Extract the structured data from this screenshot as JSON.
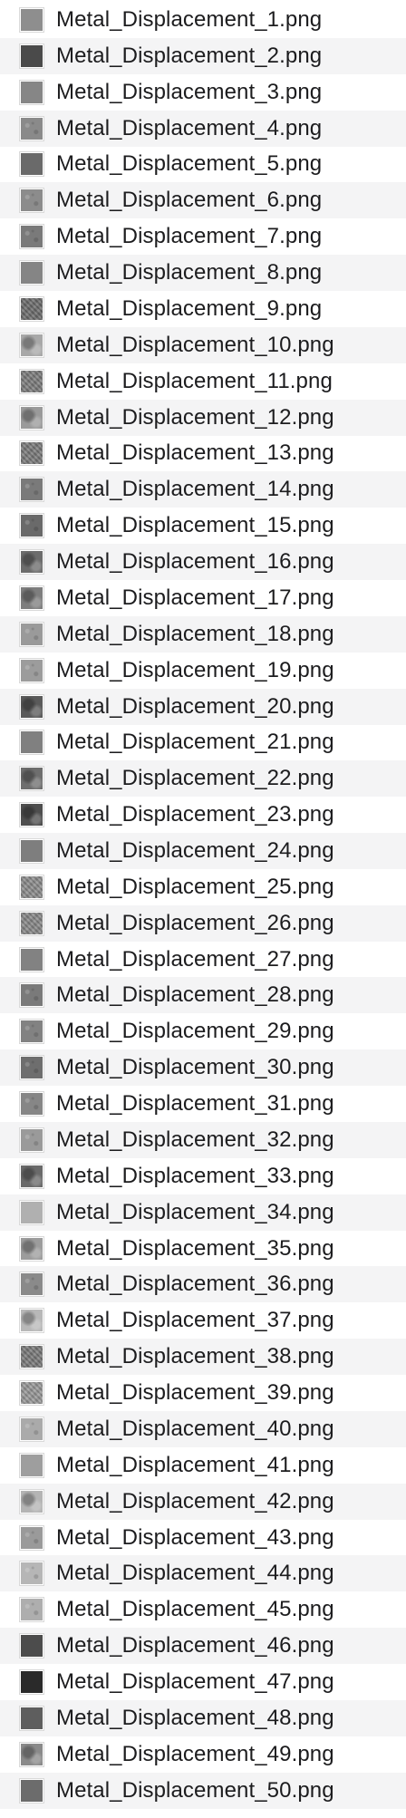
{
  "files": [
    {
      "name": "Metal_Displacement_1.png",
      "tone": "#8e8e8e",
      "texture": "smooth"
    },
    {
      "name": "Metal_Displacement_2.png",
      "tone": "#4a4a4a",
      "texture": "smooth"
    },
    {
      "name": "Metal_Displacement_3.png",
      "tone": "#868686",
      "texture": "smooth"
    },
    {
      "name": "Metal_Displacement_4.png",
      "tone": "#8a8a8a",
      "texture": "speckle"
    },
    {
      "name": "Metal_Displacement_5.png",
      "tone": "#6a6a6a",
      "texture": "smooth"
    },
    {
      "name": "Metal_Displacement_6.png",
      "tone": "#8c8c8c",
      "texture": "speckle"
    },
    {
      "name": "Metal_Displacement_7.png",
      "tone": "#7a7a7a",
      "texture": "speckle"
    },
    {
      "name": "Metal_Displacement_8.png",
      "tone": "#858585",
      "texture": "smooth"
    },
    {
      "name": "Metal_Displacement_9.png",
      "tone": "#6e6e6e",
      "texture": "noise"
    },
    {
      "name": "Metal_Displacement_10.png",
      "tone": "#a8a8a8",
      "texture": "blotch"
    },
    {
      "name": "Metal_Displacement_11.png",
      "tone": "#7e7e7e",
      "texture": "noise"
    },
    {
      "name": "Metal_Displacement_12.png",
      "tone": "#9a9a9a",
      "texture": "blotch"
    },
    {
      "name": "Metal_Displacement_13.png",
      "tone": "#7c7c7c",
      "texture": "noise"
    },
    {
      "name": "Metal_Displacement_14.png",
      "tone": "#7a7a7a",
      "texture": "speckle"
    },
    {
      "name": "Metal_Displacement_15.png",
      "tone": "#6a6a6a",
      "texture": "speckle"
    },
    {
      "name": "Metal_Displacement_16.png",
      "tone": "#6c6c6c",
      "texture": "blotch"
    },
    {
      "name": "Metal_Displacement_17.png",
      "tone": "#7e7e7e",
      "texture": "blotch"
    },
    {
      "name": "Metal_Displacement_18.png",
      "tone": "#9a9a9a",
      "texture": "speckle"
    },
    {
      "name": "Metal_Displacement_19.png",
      "tone": "#9c9c9c",
      "texture": "speckle"
    },
    {
      "name": "Metal_Displacement_20.png",
      "tone": "#5a5a5a",
      "texture": "blotch"
    },
    {
      "name": "Metal_Displacement_21.png",
      "tone": "#808080",
      "texture": "smooth"
    },
    {
      "name": "Metal_Displacement_22.png",
      "tone": "#6e6e6e",
      "texture": "blotch"
    },
    {
      "name": "Metal_Displacement_23.png",
      "tone": "#4e4e4e",
      "texture": "blotch"
    },
    {
      "name": "Metal_Displacement_24.png",
      "tone": "#7e7e7e",
      "texture": "smooth"
    },
    {
      "name": "Metal_Displacement_25.png",
      "tone": "#8e8e8e",
      "texture": "noise"
    },
    {
      "name": "Metal_Displacement_26.png",
      "tone": "#8a8a8a",
      "texture": "noise"
    },
    {
      "name": "Metal_Displacement_27.png",
      "tone": "#828282",
      "texture": "smooth"
    },
    {
      "name": "Metal_Displacement_28.png",
      "tone": "#7a7a7a",
      "texture": "speckle"
    },
    {
      "name": "Metal_Displacement_29.png",
      "tone": "#828282",
      "texture": "speckle"
    },
    {
      "name": "Metal_Displacement_30.png",
      "tone": "#6e6e6e",
      "texture": "speckle"
    },
    {
      "name": "Metal_Displacement_31.png",
      "tone": "#868686",
      "texture": "speckle"
    },
    {
      "name": "Metal_Displacement_32.png",
      "tone": "#9a9a9a",
      "texture": "speckle"
    },
    {
      "name": "Metal_Displacement_33.png",
      "tone": "#6a6a6a",
      "texture": "blotch"
    },
    {
      "name": "Metal_Displacement_34.png",
      "tone": "#b0b0b0",
      "texture": "smooth"
    },
    {
      "name": "Metal_Displacement_35.png",
      "tone": "#9c9c9c",
      "texture": "blotch"
    },
    {
      "name": "Metal_Displacement_36.png",
      "tone": "#8a8a8a",
      "texture": "speckle"
    },
    {
      "name": "Metal_Displacement_37.png",
      "tone": "#b8b8b8",
      "texture": "blotch"
    },
    {
      "name": "Metal_Displacement_38.png",
      "tone": "#7c7c7c",
      "texture": "noise"
    },
    {
      "name": "Metal_Displacement_39.png",
      "tone": "#9a9a9a",
      "texture": "noise"
    },
    {
      "name": "Metal_Displacement_40.png",
      "tone": "#aaaaaa",
      "texture": "speckle"
    },
    {
      "name": "Metal_Displacement_41.png",
      "tone": "#9e9e9e",
      "texture": "smooth"
    },
    {
      "name": "Metal_Displacement_42.png",
      "tone": "#b4b4b4",
      "texture": "blotch"
    },
    {
      "name": "Metal_Displacement_43.png",
      "tone": "#9a9a9a",
      "texture": "speckle"
    },
    {
      "name": "Metal_Displacement_44.png",
      "tone": "#b6b6b6",
      "texture": "speckle"
    },
    {
      "name": "Metal_Displacement_45.png",
      "tone": "#aeaeae",
      "texture": "speckle"
    },
    {
      "name": "Metal_Displacement_46.png",
      "tone": "#4c4c4c",
      "texture": "smooth"
    },
    {
      "name": "Metal_Displacement_47.png",
      "tone": "#2a2a2a",
      "texture": "smooth"
    },
    {
      "name": "Metal_Displacement_48.png",
      "tone": "#5e5e5e",
      "texture": "smooth"
    },
    {
      "name": "Metal_Displacement_49.png",
      "tone": "#8a8a8a",
      "texture": "blotch"
    },
    {
      "name": "Metal_Displacement_50.png",
      "tone": "#6c6c6c",
      "texture": "smooth"
    }
  ]
}
